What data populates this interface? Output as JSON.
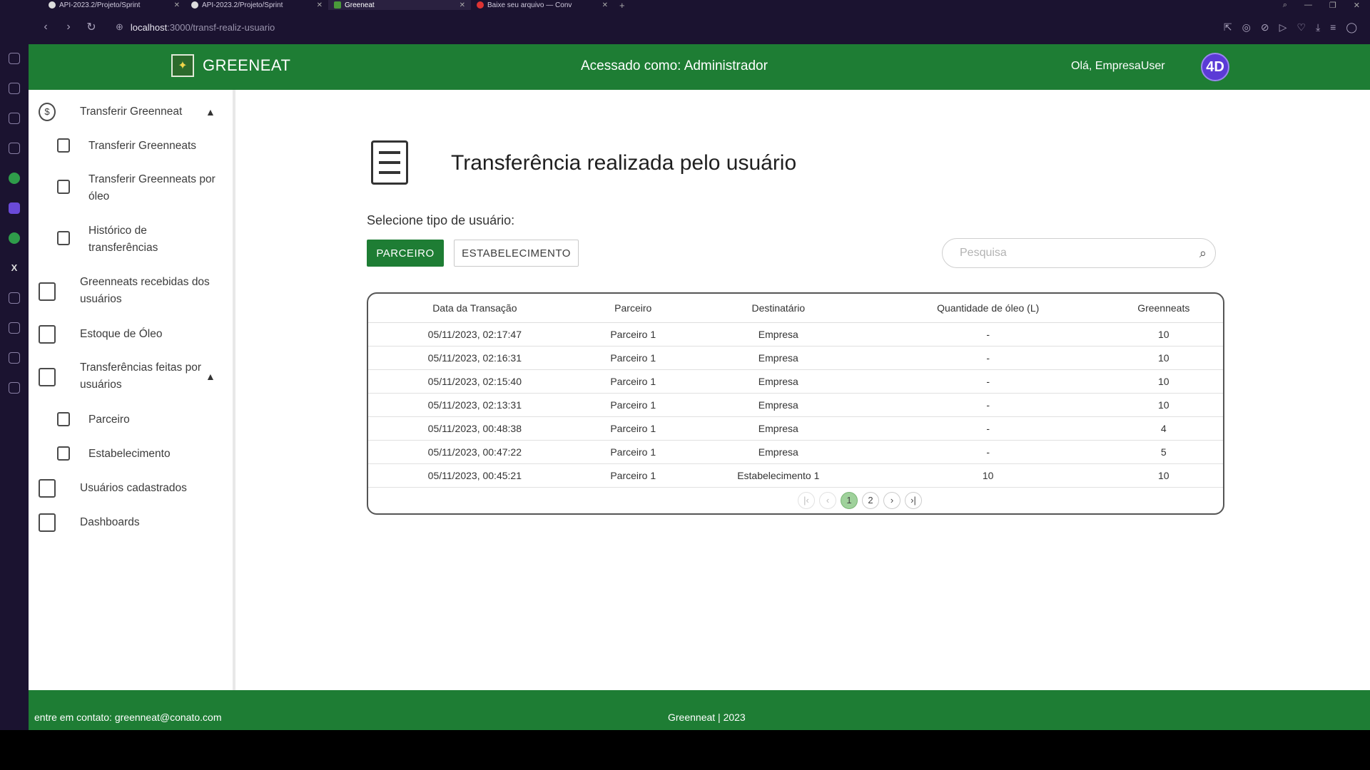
{
  "browser": {
    "tabs": [
      {
        "title": "API-2023.2/Projeto/Sprint"
      },
      {
        "title": "API-2023.2/Projeto/Sprint"
      },
      {
        "title": "Greeneat"
      },
      {
        "title": "Baixe seu arquivo — Conv"
      }
    ],
    "url_host": "localhost",
    "url_path": ":3000/transf-realiz-usuario"
  },
  "header": {
    "brand": "GREENEAT",
    "access": "Acessado como: Administrador",
    "greeting": "Olá, EmpresaUser",
    "avatar": "4D"
  },
  "sidebar": {
    "items": [
      {
        "label": "Transferir Greenneat"
      },
      {
        "label": "Transferir Greenneats"
      },
      {
        "label": "Transferir Greenneats por óleo"
      },
      {
        "label": "Histórico de transferências"
      },
      {
        "label": "Greenneats recebidas dos usuários"
      },
      {
        "label": "Estoque de Óleo"
      },
      {
        "label": "Transferências feitas por usuários"
      },
      {
        "label": "Parceiro"
      },
      {
        "label": "Estabelecimento"
      },
      {
        "label": "Usuários cadastrados"
      },
      {
        "label": "Dashboards"
      }
    ]
  },
  "main": {
    "title": "Transferência realizada pelo usuário",
    "select_label": "Selecione tipo de usuário:",
    "btn_partner": "PARCEIRO",
    "btn_establishment": "ESTABELECIMENTO",
    "search_placeholder": "Pesquisa",
    "columns": [
      "Data da Transação",
      "Parceiro",
      "Destinatário",
      "Quantidade de óleo (L)",
      "Greenneats"
    ],
    "rows": [
      [
        "05/11/2023, 02:17:47",
        "Parceiro 1",
        "Empresa",
        "-",
        "10"
      ],
      [
        "05/11/2023, 02:16:31",
        "Parceiro 1",
        "Empresa",
        "-",
        "10"
      ],
      [
        "05/11/2023, 02:15:40",
        "Parceiro 1",
        "Empresa",
        "-",
        "10"
      ],
      [
        "05/11/2023, 02:13:31",
        "Parceiro 1",
        "Empresa",
        "-",
        "10"
      ],
      [
        "05/11/2023, 00:48:38",
        "Parceiro 1",
        "Empresa",
        "-",
        "4"
      ],
      [
        "05/11/2023, 00:47:22",
        "Parceiro 1",
        "Empresa",
        "-",
        "5"
      ],
      [
        "05/11/2023, 00:45:21",
        "Parceiro 1",
        "Estabelecimento 1",
        "10",
        "10"
      ]
    ],
    "pagination": {
      "first": "|‹",
      "prev": "‹",
      "pages": [
        "1",
        "2"
      ],
      "next": "›",
      "last": "›|"
    }
  },
  "footer": {
    "contact": "entre em contato: greenneat@conato.com",
    "copyright": "Greenneat | 2023"
  },
  "colors": {
    "primary": "#1e7d34",
    "avatar": "#5b3bd6"
  }
}
